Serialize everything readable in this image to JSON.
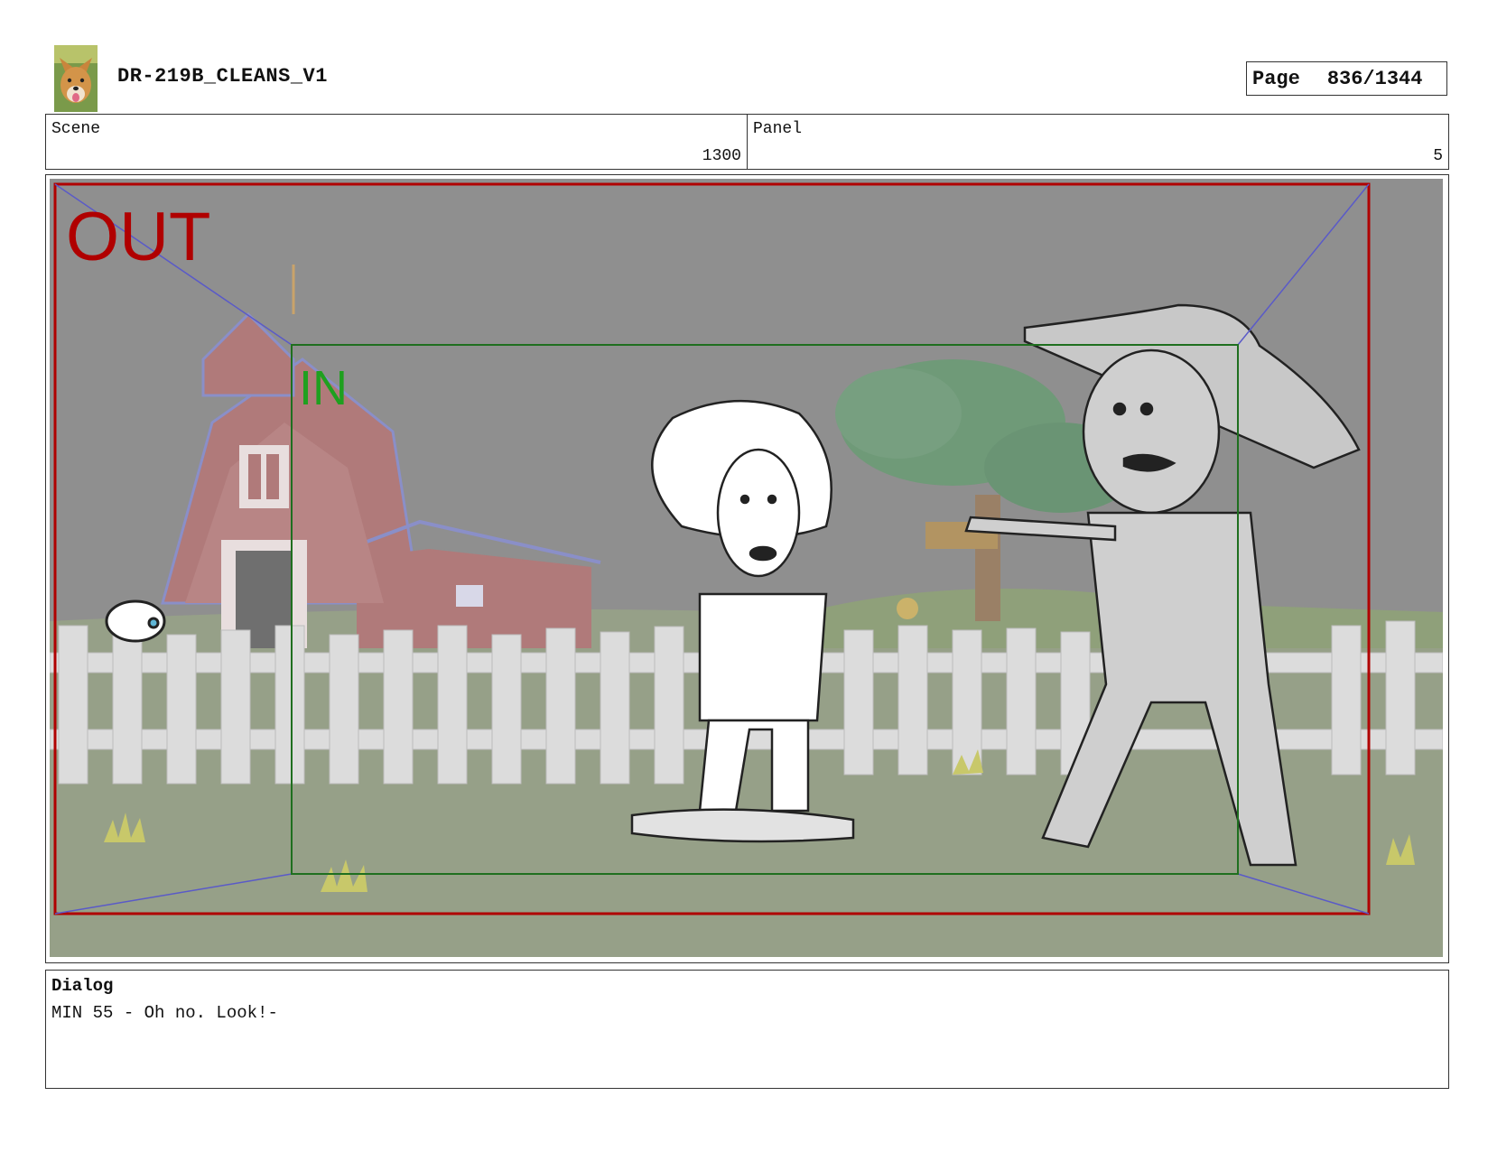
{
  "header": {
    "title": "DR-219B_CLEANS_V1",
    "page_label": "Page",
    "page_value": "836/1344"
  },
  "info": {
    "scene_label": "Scene",
    "scene_value": "1300",
    "panel_label": "Panel",
    "panel_value": "5"
  },
  "frame": {
    "out_label": "OUT",
    "in_label": "IN",
    "out_color": "#b00000",
    "in_color": "#1f8f1f"
  },
  "dialog": {
    "label": "Dialog",
    "text": "MIN 55 - Oh no. Look!-"
  }
}
